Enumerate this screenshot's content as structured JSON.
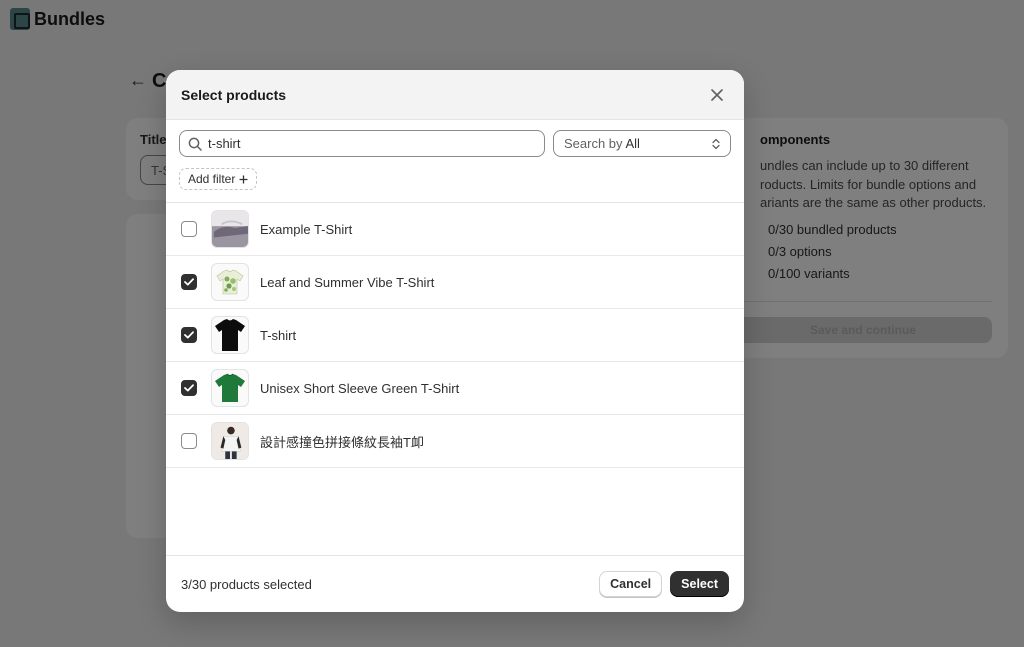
{
  "app": {
    "title": "Bundles",
    "icon": "bundle-app-icon"
  },
  "page": {
    "title_fragment": "C"
  },
  "background": {
    "title_card": {
      "label": "Title",
      "input_value_fragment": "T-S"
    },
    "components_card": {
      "heading": "omponents",
      "description": "undles can include up to 30 different\nroducts. Limits for bundle options and\nariants are the same as other products.",
      "limits": [
        "0/30 bundled products",
        "0/3 options",
        "0/100 variants"
      ],
      "save_label": "Save and continue"
    }
  },
  "modal": {
    "title": "Select products",
    "search": {
      "value": "t-shirt",
      "placeholder": ""
    },
    "search_by": {
      "prefix": "Search by",
      "value": "All"
    },
    "add_filter_label": "Add filter",
    "products": [
      {
        "name": "Example T-Shirt",
        "checked": false,
        "thumb": "gray-tshirt"
      },
      {
        "name": "Leaf and Summer Vibe T-Shirt",
        "checked": true,
        "thumb": "leaf-tshirt"
      },
      {
        "name": "T-shirt",
        "checked": true,
        "thumb": "black-tshirt"
      },
      {
        "name": "Unisex Short Sleeve Green T-Shirt",
        "checked": true,
        "thumb": "green-tshirt"
      },
      {
        "name": "設計感撞色拼接條紋長袖T卹",
        "checked": false,
        "thumb": "person-photo"
      }
    ],
    "footer": {
      "count_text": "3/30 products selected",
      "cancel_label": "Cancel",
      "select_label": "Select"
    }
  },
  "colors": {
    "primary_button": "#303030",
    "overlay": "rgba(0,0,0,0.5)",
    "leaf_green": "#7fae5a",
    "shirt_green": "#1f7a3a"
  }
}
